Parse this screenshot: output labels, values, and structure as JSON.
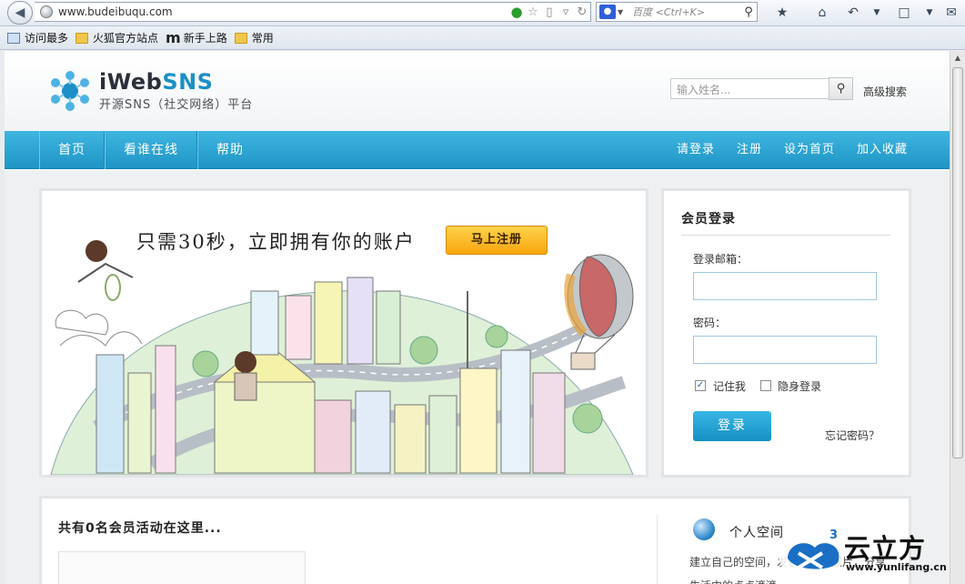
{
  "browser": {
    "url": "www.budeibuqu.com",
    "search_engine": "百度",
    "search_hint": "<Ctrl+K>"
  },
  "bookmarks": [
    {
      "label": "访问最多"
    },
    {
      "label": "火狐官方站点"
    },
    {
      "label": "新手上路"
    },
    {
      "label": "常用"
    }
  ],
  "header": {
    "brand_prefix": "iWeb",
    "brand_suffix": "SNS",
    "tagline": "开源SNS（社交网络）平台",
    "search_placeholder": "输入姓名...",
    "advanced_search": "高级搜索"
  },
  "nav": {
    "left": [
      {
        "label": "首页"
      },
      {
        "label": "看谁在线"
      },
      {
        "label": "帮助"
      }
    ],
    "right": [
      {
        "label": "请登录"
      },
      {
        "label": "注册"
      },
      {
        "label": "设为首页"
      },
      {
        "label": "加入收藏"
      }
    ]
  },
  "banner": {
    "slogan": "只需30秒，立即拥有你的账户",
    "register_button": "马上注册"
  },
  "login": {
    "title": "会员登录",
    "email_label": "登录邮箱：",
    "password_label": "密码：",
    "remember_label": "记住我",
    "remember_checked": true,
    "invisible_label": "隐身登录",
    "invisible_checked": false,
    "submit": "登录",
    "forgot": "忘记密码？"
  },
  "lower": {
    "members_text": "共有0名会员活动在这里...",
    "space_title": "个人空间",
    "space_desc": "建立自己的空间，发表日志、照片，分享生活中的点点滴滴"
  },
  "watermark": {
    "text": "云立方",
    "url": "www.yunlifang.cn",
    "badge": "3"
  },
  "colors": {
    "nav_blue": "#2aa6d8",
    "brand_blue": "#1c8fc6",
    "register_orange": "#f6a60e",
    "login_blue": "#168fc2"
  }
}
